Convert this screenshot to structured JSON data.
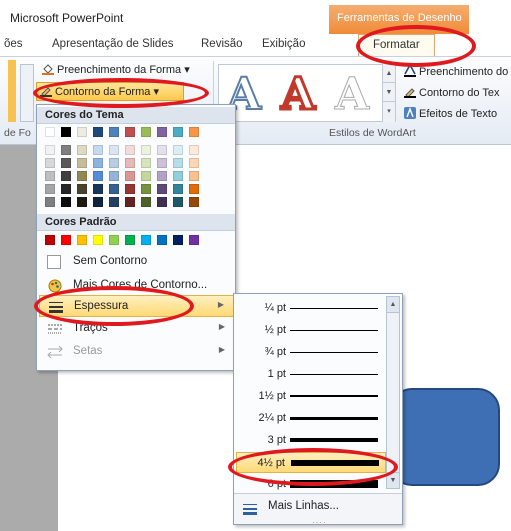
{
  "app": {
    "title": "Microsoft PowerPoint",
    "context_tab_header": "Ferramentas de Desenho"
  },
  "tabs": [
    {
      "label": "ões"
    },
    {
      "label": "Apresentação de Slides"
    },
    {
      "label": "Revisão"
    },
    {
      "label": "Exibição"
    },
    {
      "label": "Formatar"
    }
  ],
  "ribbon": {
    "shape_fill": "Preenchimento da Forma",
    "shape_outline": "Contorno da Forma",
    "group_left_label": "de Fo",
    "wordart_group_label": "Estilos de WordArt",
    "text_fill": "Preenchimento do",
    "text_outline": "Contorno do Tex",
    "text_effects": "Efeitos de Texto",
    "wordart_letter": "A"
  },
  "outline_menu": {
    "theme_colors_header": "Cores do Tema",
    "standard_colors_header": "Cores Padrão",
    "no_outline": "Sem Contorno",
    "more_colors": "Mais Cores de Contorno...",
    "weight": "Espessura",
    "dashes": "Traços",
    "arrows": "Setas"
  },
  "theme_colors": {
    "top": [
      "#ffffff",
      "#000000",
      "#eeece1",
      "#1f497d",
      "#4f81bd",
      "#c0504d",
      "#9bbb59",
      "#8064a2",
      "#4bacc6",
      "#f79646"
    ],
    "shades": [
      [
        "#f2f2f2",
        "#7f7f7f",
        "#ddd9c3",
        "#c6d9f0",
        "#dbe5f1",
        "#f2dcdb",
        "#ebf1dd",
        "#e5e0ec",
        "#dbeef3",
        "#fdeada"
      ],
      [
        "#d8d8d8",
        "#595959",
        "#c4bd97",
        "#8db3e2",
        "#b8cce4",
        "#e5b9b7",
        "#d7e3bc",
        "#ccc1d9",
        "#b7dde8",
        "#fbd5b5"
      ],
      [
        "#bfbfbf",
        "#3f3f3f",
        "#938953",
        "#548dd4",
        "#95b3d7",
        "#d99694",
        "#c3d69b",
        "#b2a2c7",
        "#92cddc",
        "#fac08f"
      ],
      [
        "#a5a5a5",
        "#262626",
        "#494429",
        "#17365d",
        "#366092",
        "#953734",
        "#76923c",
        "#5f497a",
        "#31859b",
        "#e36c09"
      ],
      [
        "#7f7f7f",
        "#0c0c0c",
        "#1d1b10",
        "#0f243e",
        "#244061",
        "#632423",
        "#4f6128",
        "#3f3151",
        "#205867",
        "#974806"
      ]
    ]
  },
  "standard_colors": [
    "#c00000",
    "#ff0000",
    "#ffc000",
    "#ffff00",
    "#92d050",
    "#00b050",
    "#00b0f0",
    "#0070c0",
    "#002060",
    "#7030a0"
  ],
  "weight_submenu": {
    "weights": [
      {
        "label": "¼ pt",
        "pt": 0.25
      },
      {
        "label": "½ pt",
        "pt": 0.5
      },
      {
        "label": "¾ pt",
        "pt": 0.75
      },
      {
        "label": "1 pt",
        "pt": 1
      },
      {
        "label": "1½ pt",
        "pt": 1.5
      },
      {
        "label": "2¼ pt",
        "pt": 2.25
      },
      {
        "label": "3 pt",
        "pt": 3
      },
      {
        "label": "4½ pt",
        "pt": 4.5
      },
      {
        "label": "6 pt",
        "pt": 6
      }
    ],
    "selected_index": 7,
    "more_lines": "Mais Linhas..."
  },
  "colors": {
    "context_tab": "#f08a36",
    "highlight": "#ffd975",
    "annotation": "#e0191e",
    "slide_shape": "#3e6fb5"
  }
}
